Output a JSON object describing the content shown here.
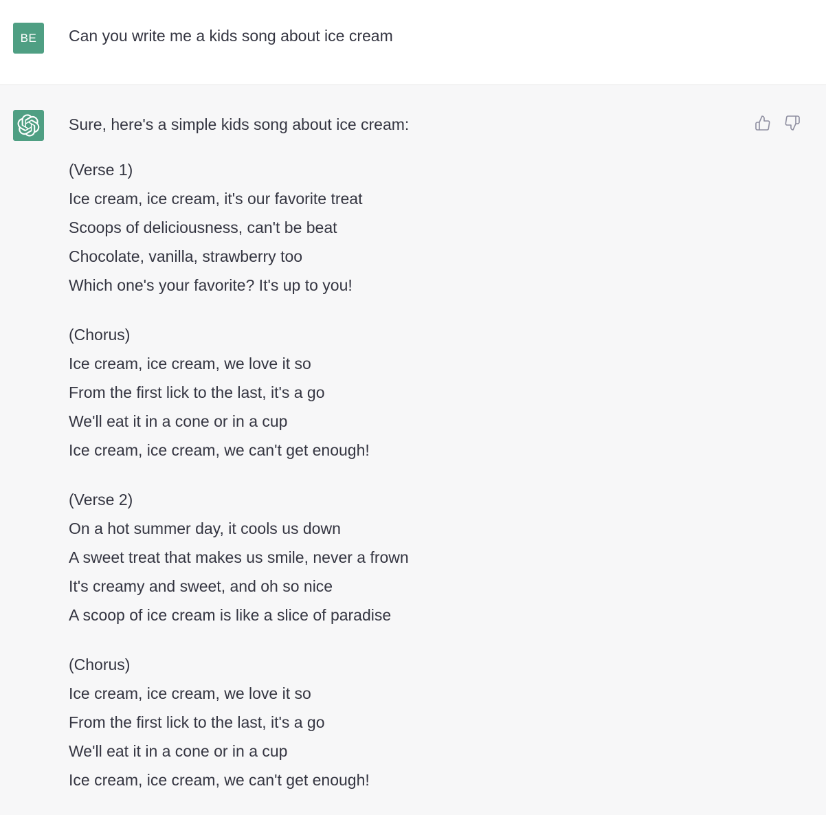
{
  "user": {
    "avatar_initials": "BE",
    "message": "Can you write me a kids song about ice cream"
  },
  "assistant": {
    "intro": "Sure, here's a simple kids song about ice cream:",
    "stanzas": [
      {
        "lines": [
          "(Verse 1)",
          "Ice cream, ice cream, it's our favorite treat",
          "Scoops of deliciousness, can't be beat",
          "Chocolate, vanilla, strawberry too",
          "Which one's your favorite? It's up to you!"
        ]
      },
      {
        "lines": [
          "(Chorus)",
          "Ice cream, ice cream, we love it so",
          "From the first lick to the last, it's a go",
          "We'll eat it in a cone or in a cup",
          "Ice cream, ice cream, we can't get enough!"
        ]
      },
      {
        "lines": [
          "(Verse 2)",
          "On a hot summer day, it cools us down",
          "A sweet treat that makes us smile, never a frown",
          "It's creamy and sweet, and oh so nice",
          "A scoop of ice cream is like a slice of paradise"
        ]
      },
      {
        "lines": [
          "(Chorus)",
          "Ice cream, ice cream, we love it so",
          "From the first lick to the last, it's a go",
          "We'll eat it in a cone or in a cup",
          "Ice cream, ice cream, we can't get enough!"
        ]
      }
    ]
  },
  "icons": {
    "assistant_avatar": "openai-logo-icon",
    "thumbs_up": "thumbs-up-icon",
    "thumbs_down": "thumbs-down-icon"
  },
  "colors": {
    "avatar_bg": "#4f9f83",
    "assistant_bg": "#f7f7f8",
    "text": "#343541",
    "icon_gray": "#8e8ea0"
  }
}
